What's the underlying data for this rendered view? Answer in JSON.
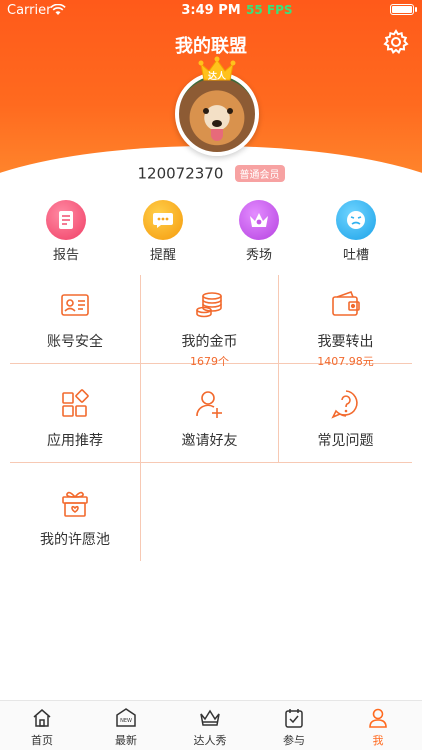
{
  "status_bar": {
    "carrier": "Carrier",
    "time": "3:49 PM",
    "fps": "55 FPS"
  },
  "header": {
    "title": "我的联盟",
    "crown_label": "达人"
  },
  "user": {
    "id": "120072370",
    "badge": "普通会员"
  },
  "quick_actions": [
    {
      "label": "报告",
      "icon": "report-icon",
      "color": "#f25a7a"
    },
    {
      "label": "提醒",
      "icon": "chat-bubble-icon",
      "color": "#f6a41a"
    },
    {
      "label": "秀场",
      "icon": "crown-icon",
      "color": "#c65ae8"
    },
    {
      "label": "吐槽",
      "icon": "face-icon",
      "color": "#32b2f0"
    }
  ],
  "grid": [
    {
      "label": "账号安全",
      "sub": "",
      "icon": "id-card-icon"
    },
    {
      "label": "我的金币",
      "sub": "1679个",
      "icon": "coins-icon"
    },
    {
      "label": "我要转出",
      "sub": "1407.98元",
      "icon": "wallet-icon"
    },
    {
      "label": "应用推荐",
      "sub": "",
      "icon": "apps-icon"
    },
    {
      "label": "邀请好友",
      "sub": "",
      "icon": "add-user-icon"
    },
    {
      "label": "常见问题",
      "sub": "",
      "icon": "question-icon"
    },
    {
      "label": "我的许愿池",
      "sub": "",
      "icon": "gift-icon"
    }
  ],
  "tabbar": [
    {
      "label": "首页",
      "icon": "home-icon",
      "active": false
    },
    {
      "label": "最新",
      "icon": "new-icon",
      "active": false
    },
    {
      "label": "达人秀",
      "icon": "crown-icon",
      "active": false
    },
    {
      "label": "参与",
      "icon": "calendar-check-icon",
      "active": false
    },
    {
      "label": "我",
      "icon": "user-icon",
      "active": true
    }
  ],
  "colors": {
    "accent": "#ff6a1f",
    "grid_line": "#f7c9b4",
    "sub_text": "#f26a2e"
  }
}
